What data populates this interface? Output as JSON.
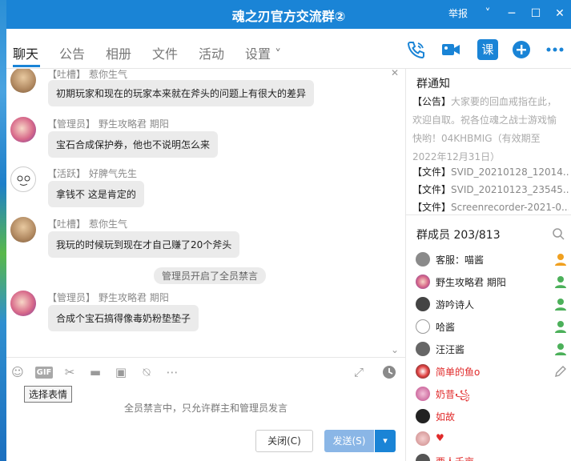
{
  "window": {
    "title": "魂之刃官方交流群②",
    "report_label": "举报",
    "chevron": "˅",
    "minimize": "─",
    "maximize": "☐",
    "close": "✕"
  },
  "tabs": [
    {
      "label": "聊天"
    },
    {
      "label": "公告"
    },
    {
      "label": "相册"
    },
    {
      "label": "文件"
    },
    {
      "label": "活动"
    },
    {
      "label": "设置 ˅"
    }
  ],
  "toolbar_icons": [
    "phone-icon",
    "video-icon",
    "class-icon",
    "add-icon",
    "more-icon"
  ],
  "class_icon_text": "课",
  "messages": [
    {
      "role": "【吐槽】",
      "nick": "惹你生气",
      "text": "初期玩家和现在的玩家本来就在斧头的问题上有很大的差异"
    },
    {
      "role": "【管理员】",
      "nick": "野生攻略君 期阳",
      "text": "宝石合成保护券，他也不说明怎么来"
    },
    {
      "role": "【活跃】",
      "nick": "好脾气先生",
      "text": "拿钱不  这是肯定的"
    },
    {
      "role": "【吐槽】",
      "nick": "惹你生气",
      "text": "我玩的时候玩到现在才自己赚了20个斧头"
    },
    {
      "role": "【管理员】",
      "nick": "野生攻略君 期阳",
      "text": "合成个宝石搞得像毒奶粉垫垫子"
    }
  ],
  "system_notice": "管理员开启了全员禁言",
  "input_toolbar": {
    "gif_label": "GIF",
    "tooltip": "选择表情",
    "muted_info": "全员禁言中，只允许群主和管理员发言"
  },
  "buttons": {
    "close": "关闭(C)",
    "send": "发送(S)",
    "send_more": "▾"
  },
  "right_panel": {
    "notice_title": "群通知",
    "notice_tag": "【公告】",
    "notice_text": "大家要的回血戒指在此，欢迎自取。祝各位魂之战士游戏愉快哟！04KHBMIG（有效期至2022年12月31日）",
    "files": [
      {
        "tag": "【文件】",
        "name": "SVID_20210128_12014..."
      },
      {
        "tag": "【文件】",
        "name": "SVID_20210123_23545..."
      },
      {
        "tag": "【文件】",
        "name": "Screenrecorder-2021-0..."
      }
    ],
    "members_title": "群成员 203/813",
    "members": [
      {
        "name": "客服：喵酱",
        "red": false
      },
      {
        "name": "野生攻略君 期阳",
        "red": false
      },
      {
        "name": "游吟诗人",
        "red": false
      },
      {
        "name": "哈酱",
        "red": false
      },
      {
        "name": "汪汪酱",
        "red": false
      },
      {
        "name": "简单的鱼o",
        "red": true
      },
      {
        "name": "奶昔꧁",
        "red": true
      },
      {
        "name": "如故",
        "red": true
      },
      {
        "name": "♥",
        "red": true
      },
      {
        "name": "西人千亩",
        "red": true
      }
    ]
  },
  "colors": {
    "accent": "#1a84d6",
    "send_disabled": "#8ab6e6",
    "admin_icon": "#f0a020",
    "member_icon": "#4cb05a",
    "red_name": "#e02a2a"
  }
}
